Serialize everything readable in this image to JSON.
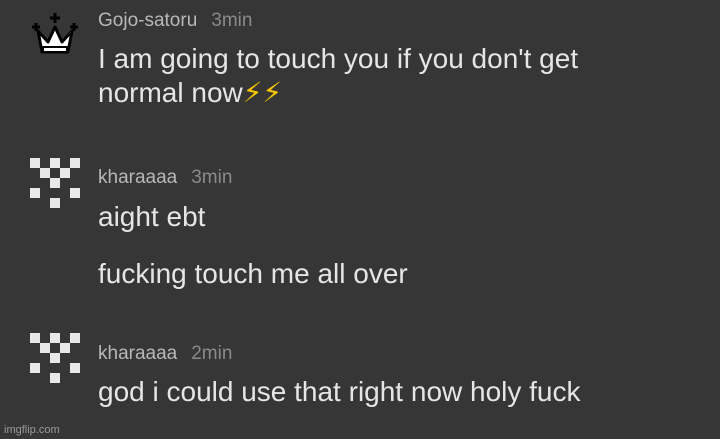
{
  "colors": {
    "background": "#363636",
    "username": "#b8b8b8",
    "timestamp": "#8a8a8a",
    "message_text": "#e6e6e6",
    "emoji": "#f5c400"
  },
  "messages": [
    {
      "username": "Gojo-satoru",
      "time": "3min",
      "avatar_icon": "crown-icon",
      "lines": [
        "I am going to touch you if you don't get",
        "normal now"
      ],
      "emoji": "⚡⚡"
    },
    {
      "username": "kharaaaa",
      "time": "3min",
      "avatar_icon": "pixel-pattern-icon",
      "lines": [
        "aight ebt",
        "fucking touch me all over"
      ]
    },
    {
      "username": "kharaaaa",
      "time": "2min",
      "avatar_icon": "pixel-pattern-icon",
      "lines": [
        "god i could use that right now holy fuck"
      ]
    }
  ],
  "watermark": "imgflip.com"
}
